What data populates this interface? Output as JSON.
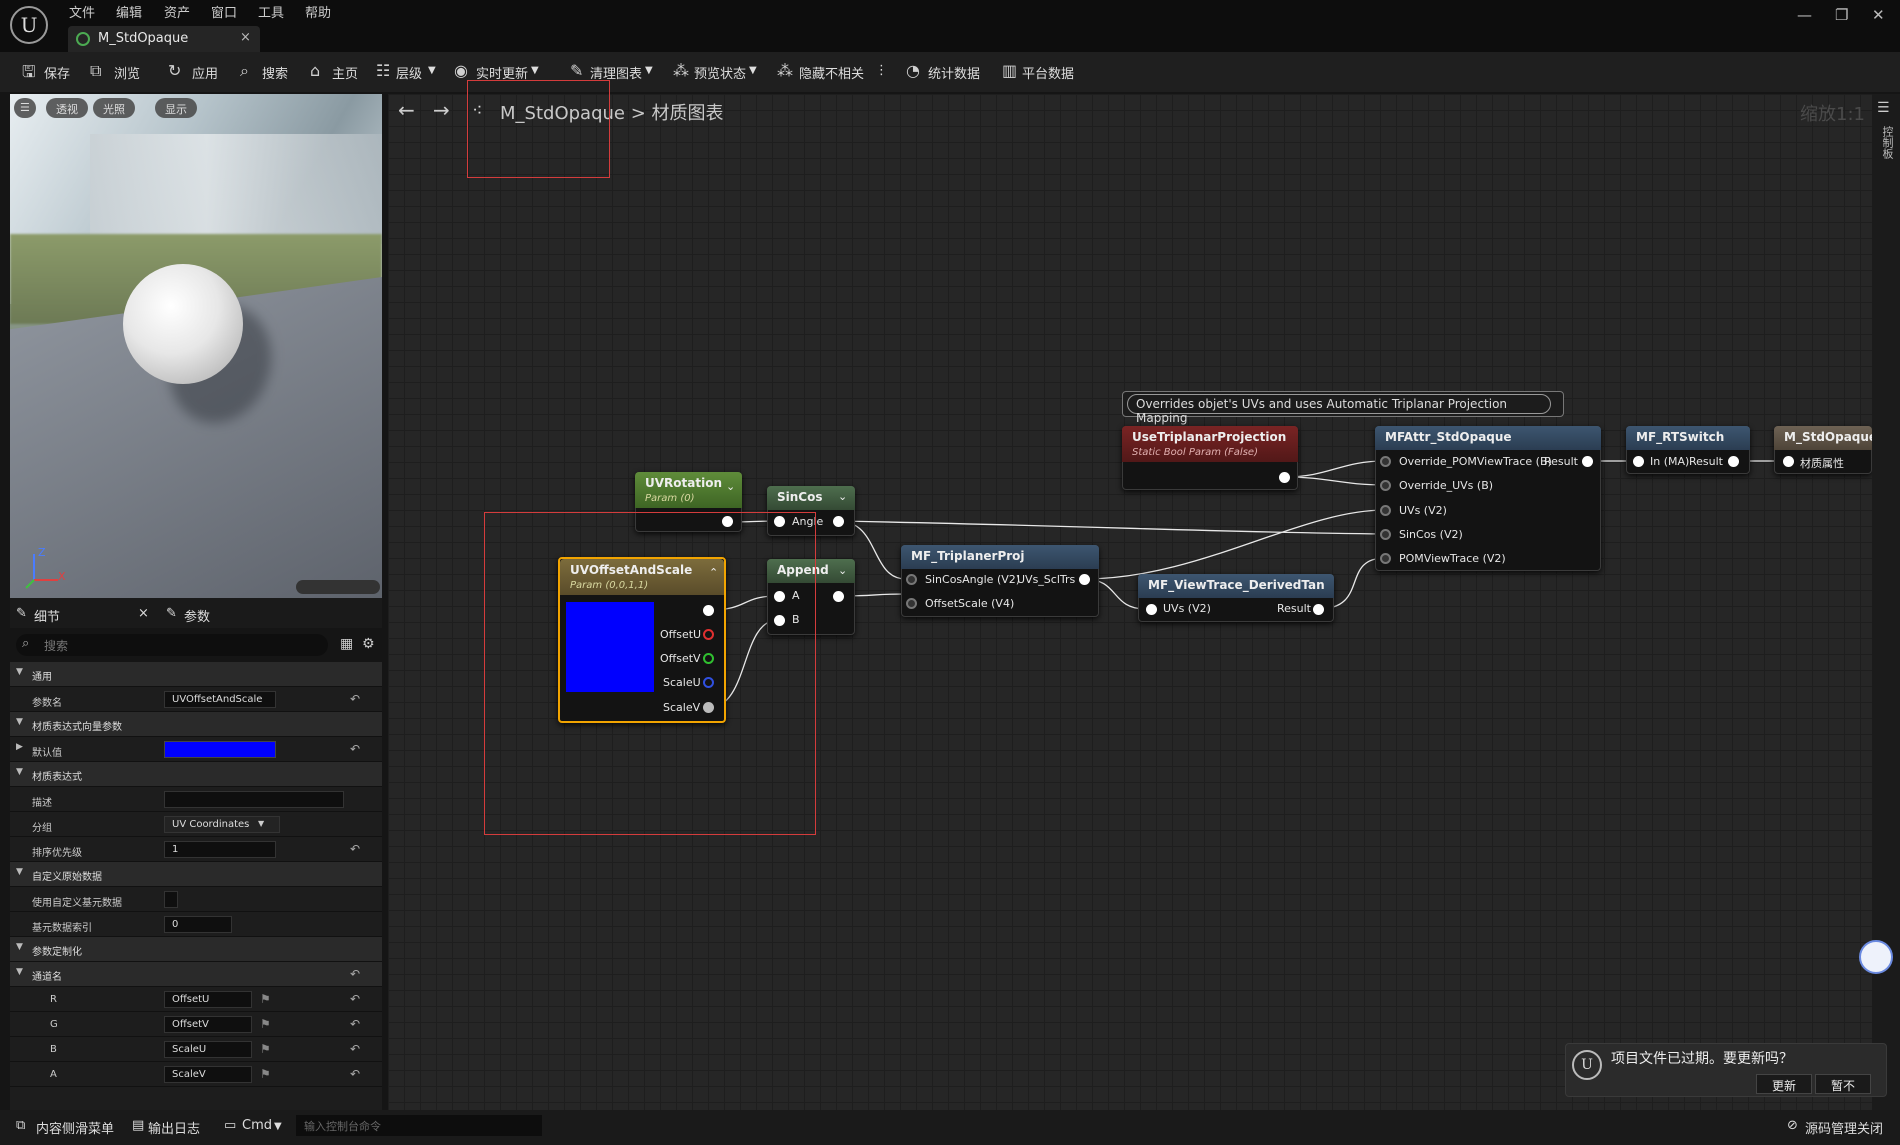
{
  "menu": [
    "文件",
    "编辑",
    "资产",
    "窗口",
    "工具",
    "帮助"
  ],
  "tab": {
    "title": "M_StdOpaque",
    "close": "×"
  },
  "window_controls": [
    "—",
    "❐",
    "✕"
  ],
  "toolbar": [
    {
      "icon": "save-icon",
      "label": "保存"
    },
    {
      "icon": "browse-icon",
      "label": "浏览"
    },
    {
      "icon": "apply-icon",
      "label": "应用"
    },
    {
      "icon": "search-icon",
      "label": "搜索"
    },
    {
      "icon": "home-icon",
      "label": "主页"
    },
    {
      "icon": "hierarchy-icon",
      "label": "层级"
    },
    {
      "icon": "live-update-icon",
      "label": "实时更新"
    },
    {
      "icon": "clean-graph-icon",
      "label": "清理图表"
    },
    {
      "icon": "preview-state-icon",
      "label": "预览状态"
    },
    {
      "icon": "hide-unrelated-icon",
      "label": "隐藏不相关"
    },
    {
      "icon": "stats-icon",
      "label": "统计数据"
    },
    {
      "icon": "platform-stats-icon",
      "label": "平台数据"
    }
  ],
  "viewport": {
    "buttons": [
      "透视",
      "光照",
      "显示"
    ],
    "axis_labels": {
      "z": "Z",
      "x": "X"
    }
  },
  "details": {
    "tabs": [
      "细节",
      "参数"
    ],
    "search_placeholder": "搜索",
    "rows": [
      {
        "type": "section",
        "label": "通用"
      },
      {
        "type": "prop",
        "label": "参数名",
        "value": "UVOffsetAndScale",
        "reset": true
      },
      {
        "type": "section",
        "label": "材质表达式向量参数"
      },
      {
        "type": "prop",
        "label": "默认值",
        "value": "",
        "color": "#0000ff",
        "reset": true
      },
      {
        "type": "section",
        "label": "材质表达式"
      },
      {
        "type": "prop",
        "label": "描述",
        "value": ""
      },
      {
        "type": "prop",
        "label": "分组",
        "value": "UV Coordinates"
      },
      {
        "type": "prop",
        "label": "排序优先级",
        "value": "1",
        "reset": true
      },
      {
        "type": "section",
        "label": "自定义原始数据"
      },
      {
        "type": "prop",
        "label": "使用自定义基元数据",
        "value": ""
      },
      {
        "type": "prop",
        "label": "基元数据索引",
        "value": "0"
      },
      {
        "type": "section",
        "label": "参数定制化"
      },
      {
        "type": "section",
        "label": "通道名",
        "reset": true
      },
      {
        "type": "channel",
        "label": "R",
        "value": "OffsetU",
        "reset": true
      },
      {
        "type": "channel",
        "label": "G",
        "value": "OffsetV",
        "reset": true
      },
      {
        "type": "channel",
        "label": "B",
        "value": "ScaleU",
        "reset": true
      },
      {
        "type": "channel",
        "label": "A",
        "value": "ScaleV",
        "reset": true
      }
    ]
  },
  "graph": {
    "breadcrumb_root": "M_StdOpaque",
    "breadcrumb_sep": ">",
    "breadcrumb_leaf": "材质图表",
    "zoom": "缩放1:1",
    "comment": "Overrides objet's UVs and uses Automatic Triplanar Projection Mapping",
    "nodes": {
      "uvrotation": {
        "title": "UVRotation",
        "subtitle": "Param (0)"
      },
      "sincos": {
        "title": "SinCos",
        "pin_angle": "Angle"
      },
      "uvoffset": {
        "title": "UVOffsetAndScale",
        "subtitle": "Param (0,0,1,1)",
        "swatch": "#0000ff",
        "pins": [
          "OffsetU",
          "OffsetV",
          "ScaleU",
          "ScaleV"
        ]
      },
      "append": {
        "title": "Append",
        "pins": [
          "A",
          "B"
        ]
      },
      "triplanar": {
        "title": "MF_TriplanerProj",
        "in1": "SinCosAngle (V2)",
        "out1": "UVs_SclTrs",
        "in2": "OffsetScale (V4)"
      },
      "viewtrace": {
        "title": "MF_ViewTrace_DerivedTan",
        "in1": "UVs (V2)",
        "out1": "Result"
      },
      "usetriplanar": {
        "title": "UseTriplanarProjection",
        "subtitle": "Static Bool Param (False)"
      },
      "mfattr": {
        "title": "MFAttr_StdOpaque",
        "pins": [
          "Override_POMViewTrace (B)",
          "Override_UVs (B)",
          "UVs (V2)",
          "SinCos (V2)",
          "POMViewTrace (V2)"
        ],
        "out1": "Result"
      },
      "rtswitch": {
        "title": "MF_RTSwitch",
        "in1": "In (MA)",
        "out1": "Result"
      },
      "stdopaque": {
        "title": "M_StdOpaque",
        "in1": "材质属性"
      }
    }
  },
  "statusbar": {
    "items": [
      "内容侧滑菜单",
      "输出日志",
      "Cmd"
    ],
    "console_placeholder": "输入控制台命令",
    "source_control": "源码管理关闭"
  },
  "toast": {
    "message": "项目文件已过期。要更新吗？",
    "update": "更新",
    "later": "暂不"
  },
  "right_panel": {
    "label": "控制板"
  }
}
